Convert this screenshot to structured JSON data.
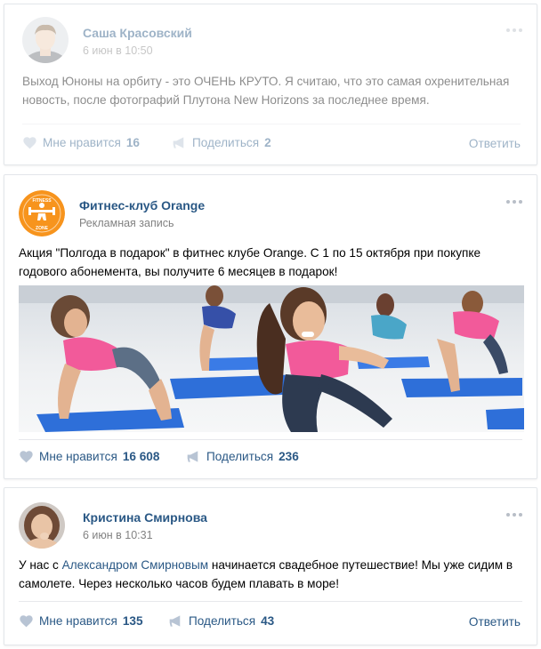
{
  "posts": [
    {
      "author": "Саша Красовский",
      "date": "6 июн в 10:50",
      "text": "Выход Юноны на орбиту - это ОЧЕНЬ КРУТО. Я считаю, что это самая охренительная новость, после фотографий Плутона New Horizons за последнее время.",
      "like_label": "Мне нравится",
      "like_count": "16",
      "share_label": "Поделиться",
      "share_count": "2",
      "reply_label": "Ответить"
    },
    {
      "author": "Фитнес-клуб Orange",
      "subtitle": "Рекламная запись",
      "text": "Акция \"Полгода в подарок\" в фитнес клубе Orange. С 1 по 15 октября при покупке годового абонемента, вы получите 6 месяцев в подарок!",
      "logo_text_top": "FITNESS",
      "logo_text_bottom": "ZONE",
      "like_label": "Мне нравится",
      "like_count": "16 608",
      "share_label": "Поделиться",
      "share_count": "236"
    },
    {
      "author": "Кристина Смирнова",
      "date": "6 июн в 10:31",
      "text_before": "У нас с ",
      "text_link": "Александром Смирновым",
      "text_after": " начинается свадебное путешествие! Мы уже сидим в самолете. Через несколько часов будем плавать в море!",
      "like_label": "Мне нравится",
      "like_count": "135",
      "share_label": "Поделиться",
      "share_count": "43",
      "reply_label": "Ответить"
    }
  ],
  "colors": {
    "link": "#2a5885",
    "brand_orange": "#f7941d",
    "mat_blue": "#2e6fd9",
    "icon_gray": "#b8c4d4"
  },
  "icons": [
    "heart-icon",
    "megaphone-icon",
    "more-dots-icon"
  ]
}
